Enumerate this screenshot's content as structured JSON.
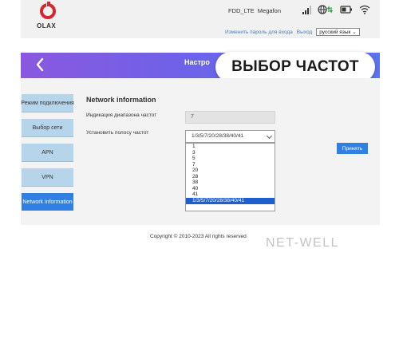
{
  "brand": {
    "logo_text": "OLAX"
  },
  "status": {
    "network_type": "FDD_LTE",
    "operator": "Megafon"
  },
  "user_bar": {
    "change_password": "Изменить пароль для входа",
    "logout": "Выход",
    "language": "русский язык"
  },
  "header": {
    "title": "Настро"
  },
  "overlay": {
    "text": "ВЫБОР ЧАСТОТ"
  },
  "sidebar": {
    "items": [
      {
        "label": "Режим подключения",
        "active": false
      },
      {
        "label": "Выбор сети",
        "active": false
      },
      {
        "label": "APN",
        "active": false
      },
      {
        "label": "VPN",
        "active": false
      },
      {
        "label": "Network information",
        "active": true
      }
    ]
  },
  "main": {
    "title": "Network information",
    "band_indication": {
      "label": "Индикация диапазона частот",
      "value": "7"
    },
    "band_setting": {
      "label": "Установить полосу частот",
      "selected": "1/3/5/7/20/28/38/40/41",
      "options": [
        "1",
        "3",
        "5",
        "7",
        "20",
        "28",
        "38",
        "40",
        "41",
        "1/3/5/7/20/28/38/40/41"
      ]
    },
    "apply_label": "Принять"
  },
  "footer": {
    "copyright": "Copyright © 2010-2023 All rights reserved"
  },
  "watermark": {
    "text": "NET-WELL"
  },
  "colors": {
    "accent": "#2f80e2",
    "side_button": "#b7d5ea",
    "brand": "#d2282e",
    "header_start": "#8a58e0",
    "header_end": "#5a74ef"
  }
}
